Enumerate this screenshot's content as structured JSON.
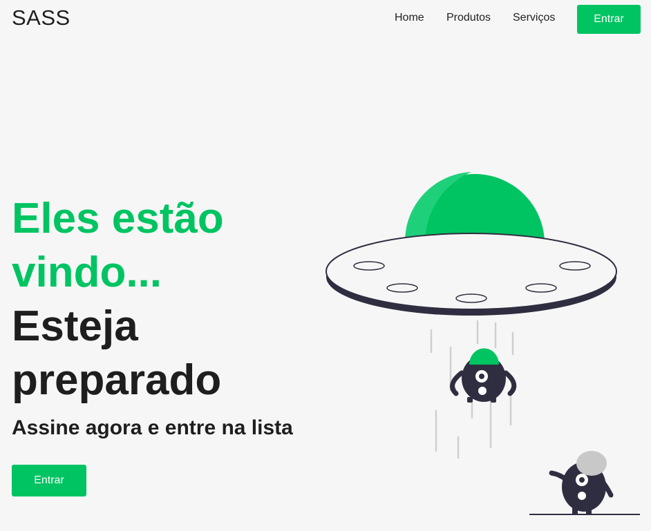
{
  "header": {
    "logo": "SASS",
    "nav": [
      "Home",
      "Produtos",
      "Serviços"
    ],
    "cta_label": "Entrar"
  },
  "hero": {
    "line_green_1": "Eles estão",
    "line_green_2": "vindo...",
    "line_dark_1": "Esteja",
    "line_dark_2": "preparado",
    "subtitle": "Assine agora e entre na lista",
    "cta_label": "Entrar"
  },
  "colors": {
    "accent": "#00c462",
    "background": "#f6f6f6",
    "text": "#1e1e1e",
    "illustration_dark": "#2f2e41"
  },
  "illustration": {
    "icon": "ufo-alien-abduction-illustration"
  }
}
